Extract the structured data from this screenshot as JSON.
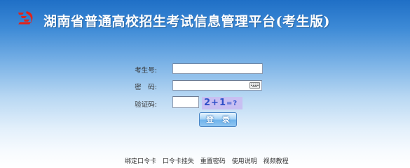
{
  "header": {
    "title": "湖南省普通高校招生考试信息管理平台(考生版)",
    "logo_icon": "red-flame-logo-icon",
    "brand_color": "#e2231a"
  },
  "login_form": {
    "exam_no_label": "考生号:",
    "exam_no_value": "",
    "password_label": "密　码:",
    "password_value": "",
    "keyboard_icon": "soft-keyboard-icon",
    "captcha_label": "验证码:",
    "captcha_value": "",
    "captcha_question": "2+1",
    "captcha_suffix": "=?",
    "submit_label": "登 录"
  },
  "footer": {
    "links": [
      "绑定口令卡",
      "口令卡挂失",
      "重置密码",
      "使用说明",
      "视频教程"
    ]
  }
}
